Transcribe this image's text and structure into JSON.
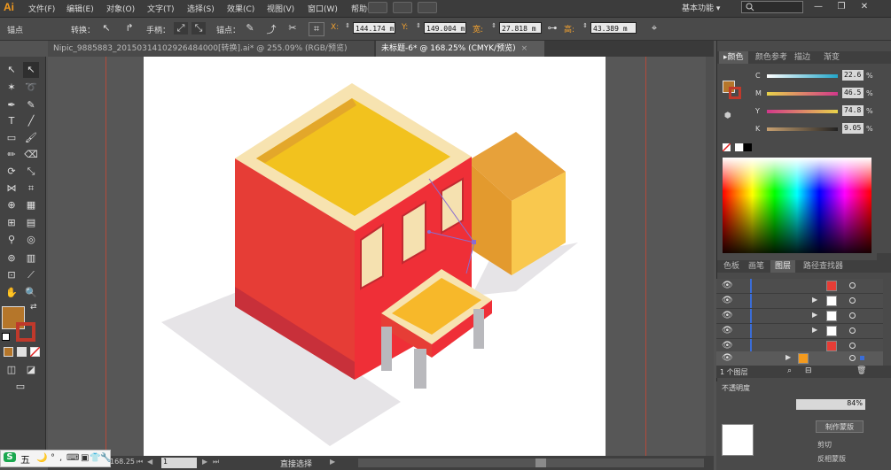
{
  "menubar": {
    "logo": "Ai",
    "items": [
      "文件(F)",
      "编辑(E)",
      "对象(O)",
      "文字(T)",
      "选择(S)",
      "效果(C)",
      "视图(V)",
      "窗口(W)",
      "帮助(H)"
    ],
    "workspace": "基本功能",
    "workspace_arrow": "▾",
    "minimize": "—",
    "restore": "❐",
    "close": "✕"
  },
  "controlbar": {
    "selection_label": "锚点",
    "convert_label": "转换：",
    "handles_label": "手柄：",
    "anchor_label": "锚点：",
    "x_label": "X:",
    "x_value": "144.174 m",
    "y_label": "Y:",
    "y_value": "149.004 m",
    "w_label": "宽:",
    "w_value": "27.818 m",
    "h_label": "高:",
    "h_value": "43.389 m"
  },
  "tabs": [
    {
      "label": "Nipic_9885883_20150314102926484000[转换].ai* @ 255.09% (RGB/预览)",
      "close": "×"
    },
    {
      "label": "未标题-6* @ 168.25% (CMYK/预览)",
      "close": "×"
    }
  ],
  "statusbar": {
    "zoom": "168.25",
    "page": "1",
    "tool_name": "直接选择"
  },
  "colors": {
    "fill": "#b5762a",
    "stroke": "#c0392b",
    "accent_orange": "#f39a1e",
    "cyan": "#22a6c9",
    "magenta": "#d1378a",
    "yellow": "#e8d34a",
    "black": "#222222"
  },
  "color_panel": {
    "tabs": [
      "颜色",
      "颜色参考",
      "描边",
      "渐变"
    ],
    "channels": [
      {
        "name": "C",
        "value": "22.6",
        "unit": "%"
      },
      {
        "name": "M",
        "value": "46.5",
        "unit": "%"
      },
      {
        "name": "Y",
        "value": "74.8",
        "unit": "%"
      },
      {
        "name": "K",
        "value": "9.05",
        "unit": "%"
      }
    ]
  },
  "layers_panel": {
    "tabs": [
      "色板",
      "画笔",
      "图层",
      "路径查找器"
    ],
    "footer_text": "1 个图层",
    "rows": 6
  },
  "lower_panel": {
    "opacity_label": "不透明度",
    "opacity_value": "84%",
    "make_mask_button": "制作蒙版",
    "clip_label": "剪切",
    "invert_mask_label": "反相蒙版"
  },
  "ime": {
    "label": "五",
    "icons": [
      "S",
      "🌙",
      "°",
      ",",
      "⌨",
      "▣",
      "👕",
      "🔧"
    ]
  }
}
